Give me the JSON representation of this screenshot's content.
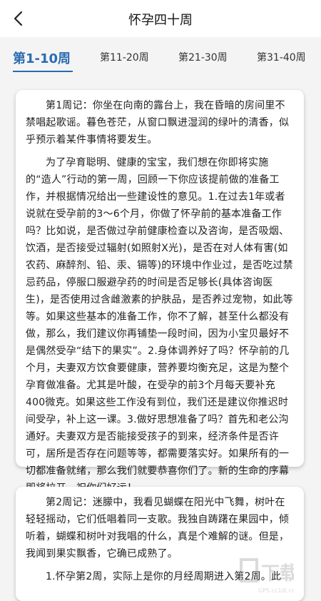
{
  "header": {
    "title": "怀孕四十周",
    "back_icon": "back-arrow-icon"
  },
  "tabs": [
    {
      "label": "第1-10周",
      "active": true
    },
    {
      "label": "第11-20周",
      "active": false
    },
    {
      "label": "第21-30周",
      "active": false
    },
    {
      "label": "第31-40周",
      "active": false
    }
  ],
  "articles": [
    {
      "paragraphs": [
        "第1周记：你坐在向南的露台上，我在昏暗的房间里不禁唱起歌谣。暮色苍茫，从窗口飘进湿润的绿叶的清香，似乎预示着某件事情将要发生。",
        "为了孕育聪明、健康的宝宝，我们想在你即将实施的“造人”行动的第一周，回顾一下你应该提前做的准备工作，并根据情况给出一些建设性的意见。1.在过去1年或者说就在受孕前的3～6个月，你做了怀孕前的基本准备工作吗？比如说，是否做过孕前健康检查以及咨询，是否吸烟、饮酒，是否接受过辐射(如照射X光)，是否在对人体有害(如农药、麻醉剂、铅、汞、镉等)的环境中作业过，是否吃过禁忌药品，停服口服避孕药的时间是否足够长(具体咨询医生)，是否使用过含雌激素的护肤品，是否养过宠物，如此等等。如果这些基本的准备工作，你不了解，甚至什么都没有做，那么，我们建议你再铺垫一段时间，因为小宝贝最好不是偶然受孕“结下的果实”。2.身体调养好了吗？怀孕前的几个月，夫妻双方饮食要健康，营养要均衡充足，这是为整个孕育做准备。尤其是叶酸，在受孕的前3个月每天要补充400微克。如果这些工作没有到位，我们还是建议你推迟时间受孕，补上这一课。3.做好思想准备了吗？首先和老公沟通好。夫妻双方是否能接受孩子的到来，经济条件是否许可，居所是否存在问题等等，都需要落实好。如果所有的一切都准备就绪，那么我们就要恭喜你们了。新的生命的序幕即将拉开，祝你们好运！"
      ]
    },
    {
      "paragraphs": [
        "第2周记：迷朦中，我看见蝴蝶在阳光中飞舞，树叶在轻轻摇动，它们低唱着同一支歌。我独自踌躇在果园中，倾听着，蝴蝶和树叶对我唱的什么，真是个难解的谜。但是，我闻到果实飘香，它确已成熟了。",
        "1.怀孕第2周，实际上是你的月经周期进入第2周。此"
      ]
    }
  ],
  "watermark_text": "GPS.cc1dl.com"
}
